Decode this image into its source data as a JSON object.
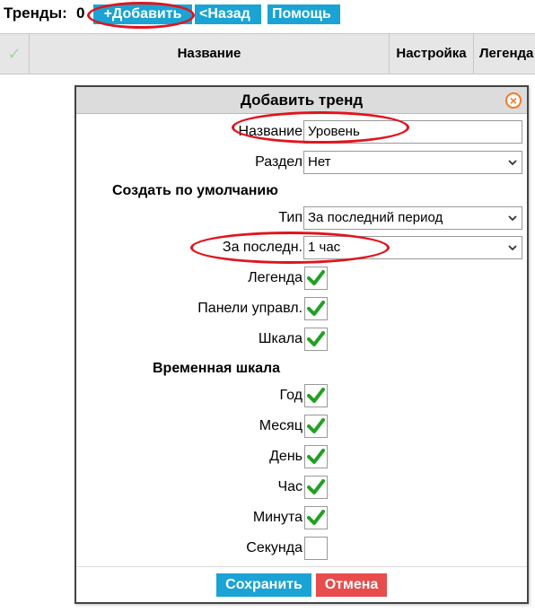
{
  "toolbar": {
    "title": "Тренды:",
    "count": "0",
    "add_label": "+Добавить",
    "back_label": "<Назад",
    "help_label": "Помощь"
  },
  "table": {
    "check_symbol": "✓",
    "columns": [
      "Название",
      "Настройка",
      "Легенда"
    ]
  },
  "dialog": {
    "title": "Добавить тренд",
    "close_symbol": "×",
    "name_label": "Название",
    "name_value": "Уровень",
    "section_label": "Раздел",
    "section_value": "Нет",
    "defaults_heading": "Создать по умолчанию",
    "type_label": "Тип",
    "type_value": "За последний период",
    "last_label": "За последн.",
    "last_value": "1 час",
    "legend_label": "Легенда",
    "legend_checked": true,
    "panels_label": "Панели управл.",
    "panels_checked": true,
    "scale_label": "Шкала",
    "scale_checked": true,
    "timescale_heading": "Временная шкала",
    "year_label": "Год",
    "year_checked": true,
    "month_label": "Месяц",
    "month_checked": true,
    "day_label": "День",
    "day_checked": true,
    "hour_label": "Час",
    "hour_checked": true,
    "minute_label": "Минута",
    "minute_checked": true,
    "second_label": "Секунда",
    "second_checked": false,
    "save_label": "Сохранить",
    "cancel_label": "Отмена"
  },
  "colors": {
    "accent": "#1aa3d4",
    "danger": "#e84c4c",
    "check": "#22a022",
    "annotation": "#e0141e"
  }
}
